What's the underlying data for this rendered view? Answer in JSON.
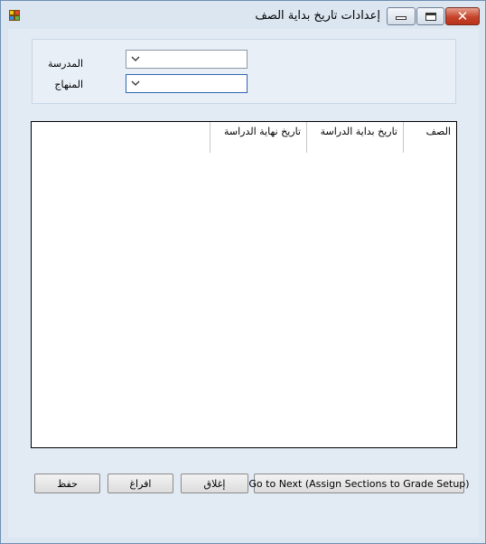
{
  "window": {
    "title": "إعدادات تاريخ بداية الصف",
    "min_symbol": "",
    "max_symbol": "",
    "close_symbol": "✕"
  },
  "filters": {
    "school_label": "المدرسة",
    "school_value": "",
    "curriculum_label": "المنهاج",
    "curriculum_value": ""
  },
  "grid": {
    "columns": [
      {
        "label": "الصف"
      },
      {
        "label": "تاريخ بداية الدراسة"
      },
      {
        "label": "تاريخ نهاية الدراسة"
      }
    ],
    "rows": []
  },
  "buttons": {
    "next": "Go to Next (Assign Sections to Grade Setup)",
    "close": "إغلاق",
    "clear": "افراغ",
    "save": "حفظ"
  },
  "colors": {
    "window_bg": "#dbe6f1",
    "close_button": "#c5432a",
    "focus_border": "#2f66b3"
  }
}
